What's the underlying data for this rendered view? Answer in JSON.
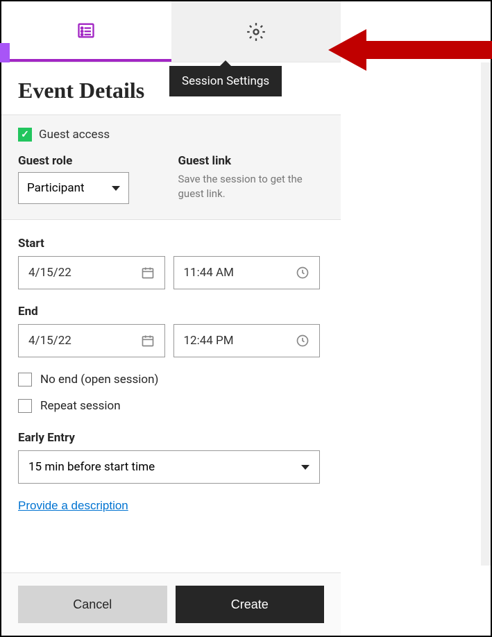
{
  "tabs": {
    "active_icon": "list-icon",
    "inactive_icon": "gear-icon",
    "tooltip": "Session Settings"
  },
  "title": "Event Details",
  "guest": {
    "checkbox_label": "Guest access",
    "checked": true,
    "role_label": "Guest role",
    "role_value": "Participant",
    "link_label": "Guest link",
    "link_hint": "Save the session to get the guest link."
  },
  "schedule": {
    "start_label": "Start",
    "start_date": "4/15/22",
    "start_time": "11:44 AM",
    "end_label": "End",
    "end_date": "4/15/22",
    "end_time": "12:44 PM",
    "no_end_label": "No end (open session)",
    "repeat_label": "Repeat session"
  },
  "early_entry": {
    "label": "Early Entry",
    "value": "15 min before start time"
  },
  "description_link": "Provide a description",
  "footer": {
    "cancel": "Cancel",
    "create": "Create"
  }
}
